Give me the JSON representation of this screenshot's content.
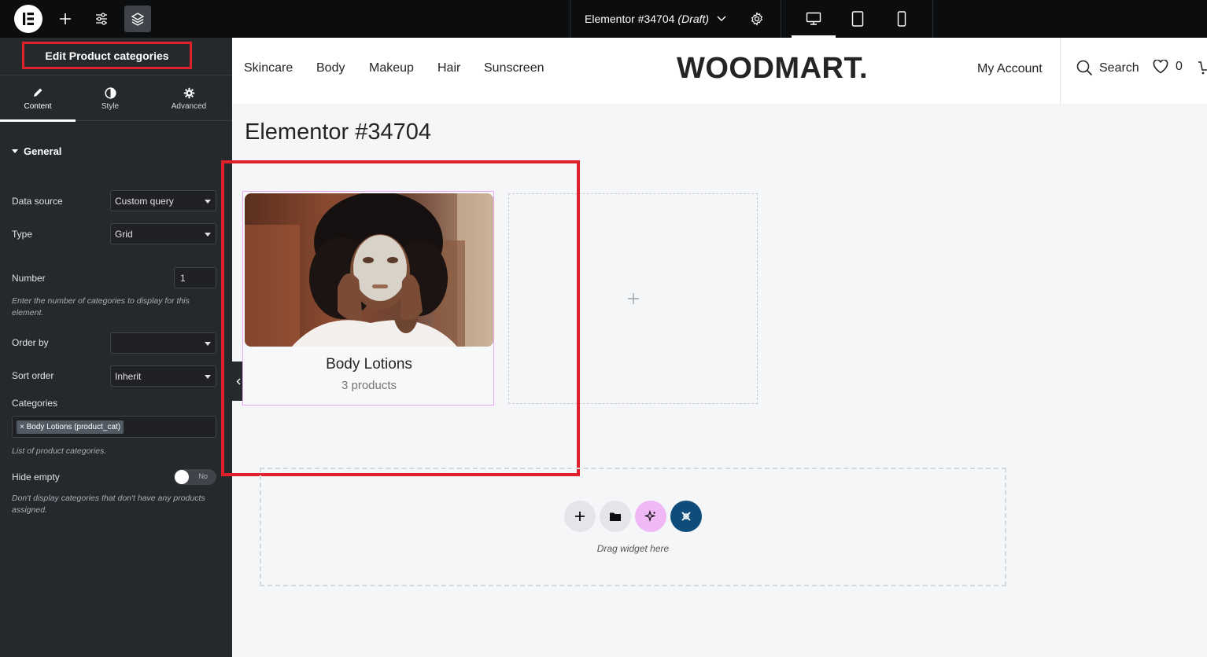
{
  "topbar": {
    "document_name": "Elementor #34704",
    "document_status": "(Draft)"
  },
  "panel": {
    "title": "Edit Product categories",
    "tabs": [
      {
        "label": "Content",
        "active": true
      },
      {
        "label": "Style",
        "active": false
      },
      {
        "label": "Advanced",
        "active": false
      }
    ],
    "section_title": "General",
    "fields": {
      "data_source": {
        "label": "Data source",
        "value": "Custom query"
      },
      "type": {
        "label": "Type",
        "value": "Grid"
      },
      "number": {
        "label": "Number",
        "value": "1",
        "help": "Enter the number of categories to display for this element."
      },
      "order_by": {
        "label": "Order by",
        "value": ""
      },
      "sort_order": {
        "label": "Sort order",
        "value": "Inherit"
      },
      "categories": {
        "label": "Categories",
        "tag": "× Body Lotions (product_cat)",
        "help": "List of product categories."
      },
      "hide_empty": {
        "label": "Hide empty",
        "value": "No",
        "help": "Don't display categories that don't have any products assigned."
      }
    }
  },
  "site": {
    "nav": [
      "Skincare",
      "Body",
      "Makeup",
      "Hair",
      "Sunscreen"
    ],
    "brand": "WOODMART.",
    "account": "My Account",
    "search": "Search",
    "wishlist_count": "0"
  },
  "page": {
    "title": "Elementor #34704",
    "category_card": {
      "name": "Body Lotions",
      "count": "3 products"
    },
    "dropzone_text": "Drag widget here"
  },
  "colors": {
    "accent_highlight": "#e0202a",
    "panel_bg": "#26292c",
    "topbar_bg": "#0c0d0e",
    "card_border": "#e6a8f5",
    "ai_button": "#f0b8f5",
    "kit_button": "#0e4d7b"
  }
}
